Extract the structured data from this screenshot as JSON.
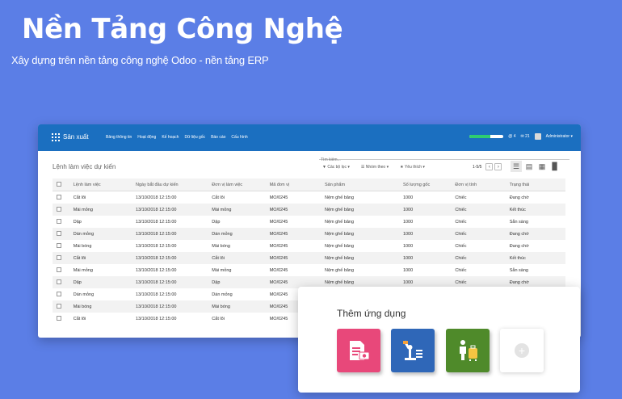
{
  "hero": {
    "title": "Nền Tảng Công Nghệ",
    "subtitle": "Xây dựng trên nền tảng công nghệ Odoo - nền tảng ERP"
  },
  "app": {
    "brand": "Sản xuất",
    "menu": [
      "Bảng thông tin",
      "Hoạt động",
      "Kế hoạch",
      "Dữ liệu gốc",
      "Báo cáo",
      "Cấu hình"
    ],
    "notifications": "4",
    "messages": "21",
    "user": "Administrator",
    "page_title": "Lệnh làm việc dự kiến",
    "search_placeholder": "Tìm kiếm...",
    "filters": [
      "Các bộ lọc",
      "Nhóm theo",
      "Yêu thích"
    ],
    "pager": "1-5/5",
    "progress_fraction": 0.62,
    "colors": {
      "topbar": "#1b6fc0",
      "background": "#5b7ee6"
    }
  },
  "table": {
    "headers": [
      "Lệnh làm việc",
      "Ngày bắt đầu dự kiến",
      "Đơn vị làm việc",
      "Mã đơn vị",
      "Sản phẩm",
      "Số lượng gốc",
      "Đơn vị tính",
      "Trạng thái"
    ],
    "rows": [
      [
        "Cắt lõi",
        "13/10/2018 12:15:00",
        "Cắt lõi",
        "MO/0245",
        "Nệm ghế băng",
        "1000",
        "Chiếc",
        "Đang chờ"
      ],
      [
        "Mài mỏng",
        "13/10/2018 12:15:00",
        "Mài mỏng",
        "MO/0245",
        "Nệm ghế băng",
        "1000",
        "Chiếc",
        "Kết thúc"
      ],
      [
        "Dập",
        "13/10/2018 12:15:00",
        "Dập",
        "MO/0245",
        "Nệm ghế băng",
        "1000",
        "Chiếc",
        "Sẵn sàng"
      ],
      [
        "Dán mỏng",
        "13/10/2018 12:15:00",
        "Dán mỏng",
        "MO/0245",
        "Nệm ghế băng",
        "1000",
        "Chiếc",
        "Đang chờ"
      ],
      [
        "Mài bóng",
        "13/10/2018 12:15:00",
        "Mài bóng",
        "MO/0245",
        "Nệm ghế băng",
        "1000",
        "Chiếc",
        "Đang chờ"
      ],
      [
        "Cắt lõi",
        "13/10/2018 12:15:00",
        "Cắt lõi",
        "MO/0245",
        "Nệm ghế băng",
        "1000",
        "Chiếc",
        "Kết thúc"
      ],
      [
        "Mài mỏng",
        "13/10/2018 12:15:00",
        "Mài mỏng",
        "MO/0245",
        "Nệm ghế băng",
        "1000",
        "Chiếc",
        "Sẵn sàng"
      ],
      [
        "Dập",
        "13/10/2018 12:15:00",
        "Dập",
        "MO/0245",
        "Nệm ghế băng",
        "1000",
        "Chiếc",
        "Đang chờ"
      ],
      [
        "Dán mỏng",
        "13/10/2018 12:15:00",
        "Dán mỏng",
        "MO/0245",
        "",
        "",
        "",
        ""
      ],
      [
        "Mài bóng",
        "13/10/2018 12:15:00",
        "Mài bóng",
        "MO/0245",
        "",
        "",
        "",
        ""
      ],
      [
        "Cắt lõi",
        "13/10/2018 12:15:00",
        "Cắt lõi",
        "MO/0245",
        "",
        "",
        "",
        ""
      ]
    ]
  },
  "add_apps": {
    "title": "Thêm ứng dụng",
    "tiles": [
      {
        "icon": "document-money-icon",
        "color": "#e8487a"
      },
      {
        "icon": "robot-arm-icon",
        "color": "#2f67b8"
      },
      {
        "icon": "traveler-luggage-icon",
        "color": "#4f8a2a"
      },
      {
        "icon": "add-icon",
        "color": "#ffffff"
      }
    ]
  }
}
